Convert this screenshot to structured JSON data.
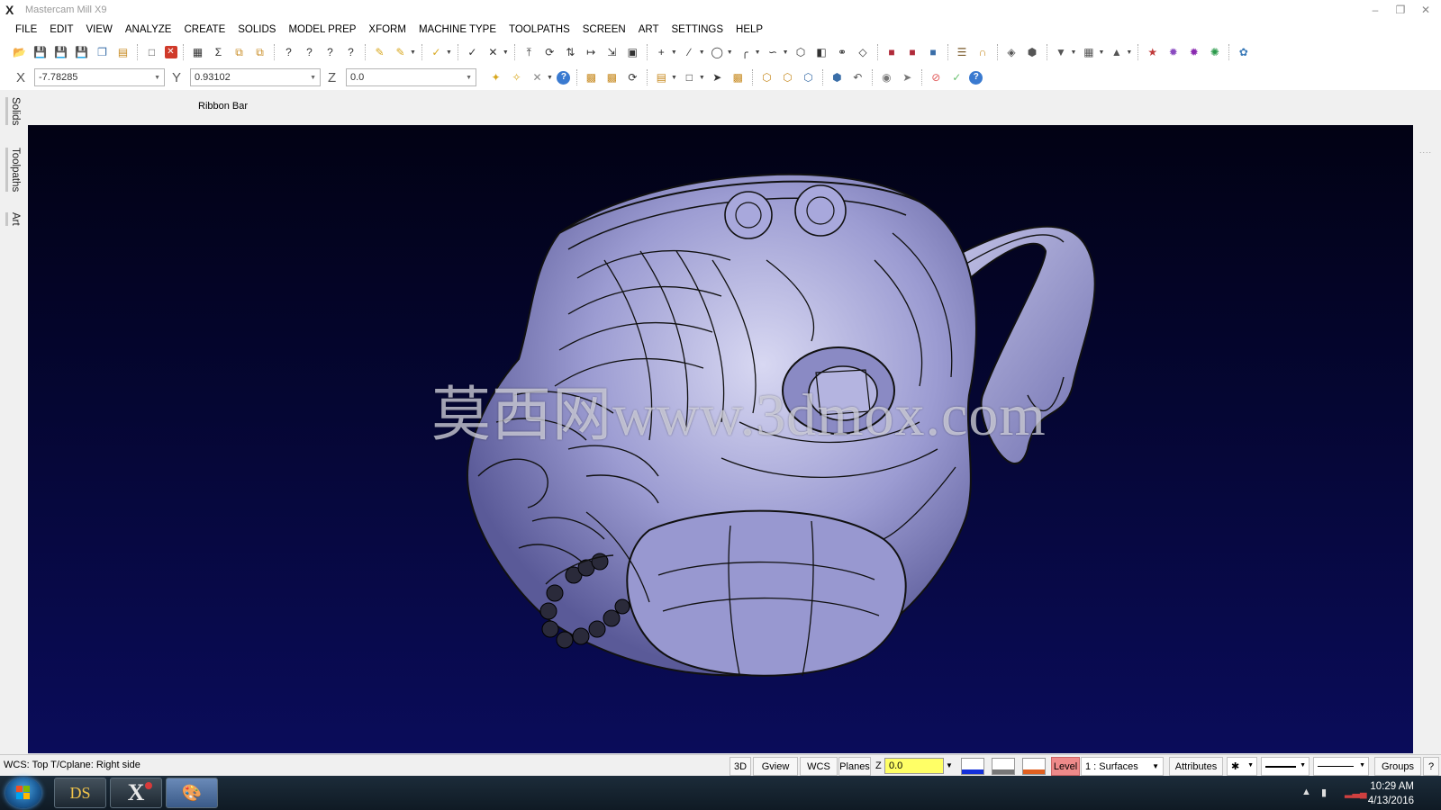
{
  "window": {
    "title": "Mastercam Mill X9",
    "controls": [
      "minimize",
      "restore",
      "close"
    ]
  },
  "menu": [
    "FILE",
    "EDIT",
    "VIEW",
    "ANALYZE",
    "CREATE",
    "SOLIDS",
    "MODEL PREP",
    "XFORM",
    "MACHINE TYPE",
    "TOOLPATHS",
    "SCREEN",
    "ART",
    "SETTINGS",
    "HELP"
  ],
  "coords": {
    "x_label": "X",
    "x_value": "-7.78285",
    "y_label": "Y",
    "y_value": "0.93102",
    "z_label": "Z",
    "z_value": "0.0"
  },
  "ribbon": {
    "label": "Ribbon Bar"
  },
  "side_tabs": [
    "Solids",
    "Toolpaths",
    "Art"
  ],
  "viewport": {
    "watermark": "莫西网www.3dmox.com",
    "background_top": "#020214",
    "background_bottom": "#0a0c5a",
    "model_color": "#9a9ad0"
  },
  "status": {
    "text": "WCS: Top  T/Cplane: Right side",
    "btn_3d": "3D",
    "btn_gview": "Gview",
    "btn_wcs": "WCS",
    "btn_planes": "Planes",
    "z_label": "Z",
    "z_value": "0.0",
    "level_label": "Level",
    "level_value": "1 : Surfaces",
    "attributes": "Attributes",
    "groups": "Groups",
    "help": "?"
  },
  "taskbar": {
    "apps": [
      "DS",
      "X"
    ],
    "time": "10:29 AM",
    "date": "4/13/2016"
  }
}
